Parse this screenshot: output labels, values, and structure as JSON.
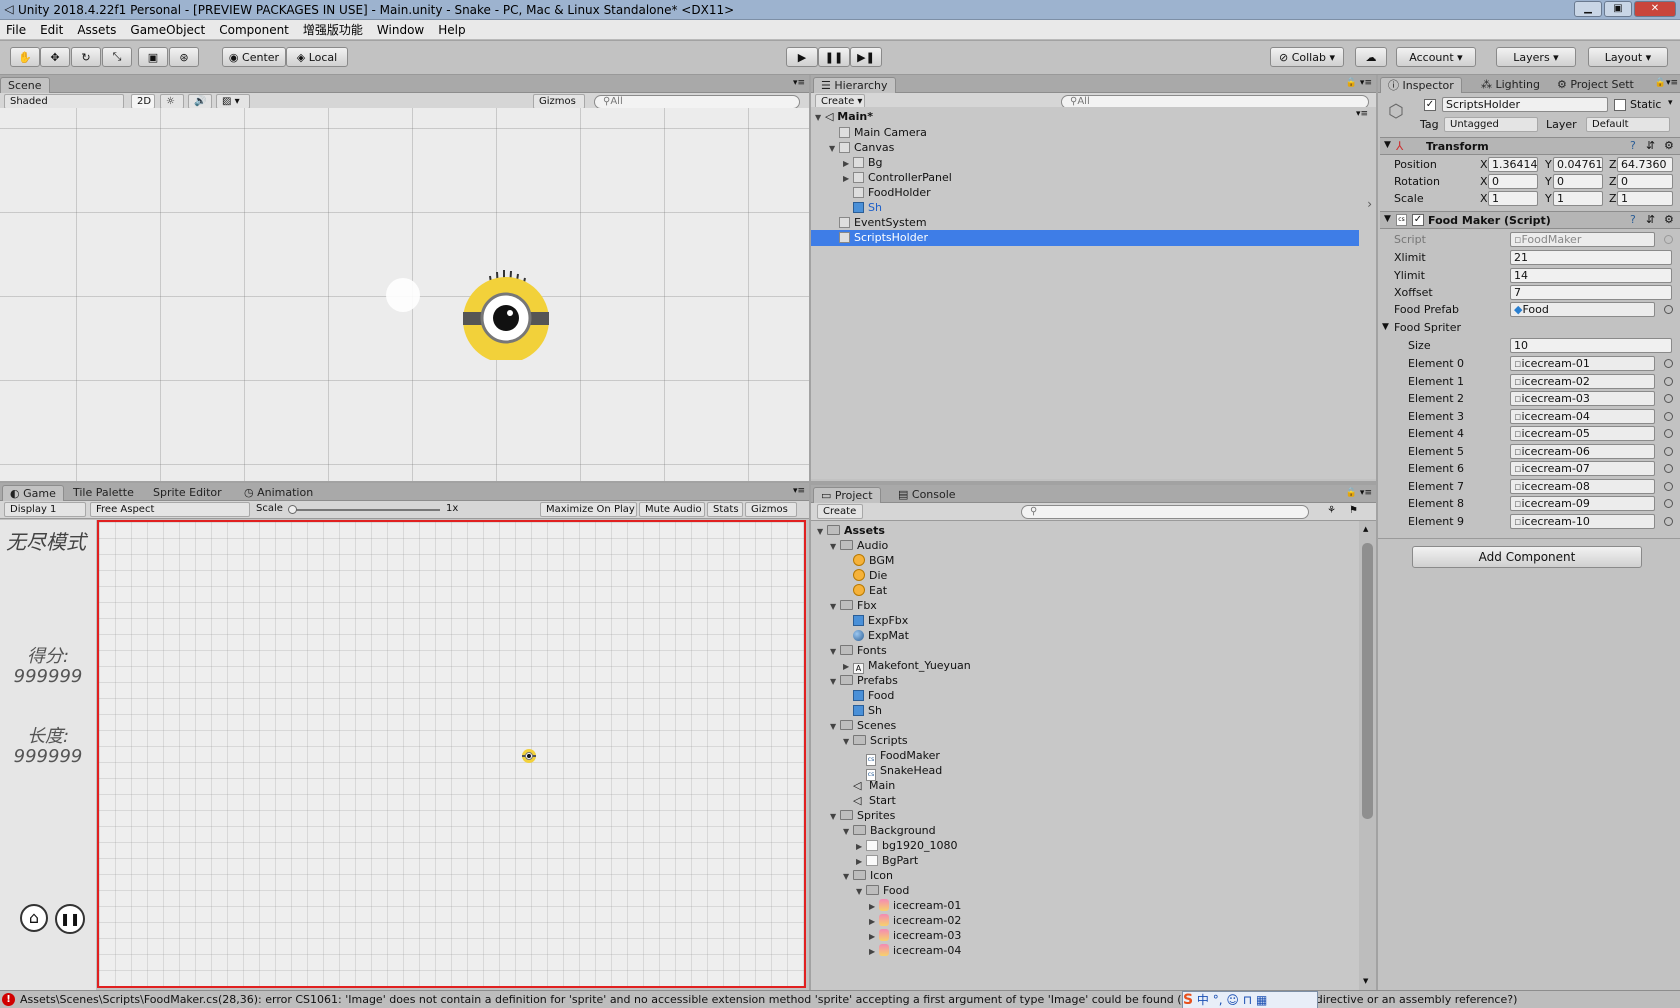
{
  "window": {
    "title": "Unity 2018.4.22f1 Personal - [PREVIEW PACKAGES IN USE] - Main.unity - Snake - PC, Mac & Linux Standalone* <DX11>",
    "controls": [
      "minimize-icon",
      "maximize-icon",
      "close-icon"
    ]
  },
  "menu": [
    "File",
    "Edit",
    "Assets",
    "GameObject",
    "Component",
    "增强版功能",
    "Window",
    "Help"
  ],
  "toolbar": {
    "pivot": "Center",
    "space": "Local",
    "collab": "Collab",
    "account": "Account",
    "layers": "Layers",
    "layout": "Layout"
  },
  "scene": {
    "tab": "Scene",
    "shading": "Shaded",
    "mode2d": "2D",
    "gizmos": "Gizmos",
    "search_placeholder": "All"
  },
  "game": {
    "tabs": [
      "Game",
      "Tile Palette",
      "Sprite Editor",
      "Animation"
    ],
    "display": "Display 1",
    "aspect": "Free Aspect",
    "scale_label": "Scale",
    "scale_value": "1x",
    "options": [
      "Maximize On Play",
      "Mute Audio",
      "Stats",
      "Gizmos"
    ],
    "mode_text": "无尽模式",
    "score_label": "得分:",
    "score_value": "999999",
    "length_label": "长度:",
    "length_value": "999999"
  },
  "hierarchy": {
    "tab": "Hierarchy",
    "create": "Create",
    "search_placeholder": "All",
    "scene": "Main*",
    "items": [
      {
        "label": "Main Camera",
        "depth": 1,
        "arrow": "",
        "blue": false,
        "selected": false
      },
      {
        "label": "Canvas",
        "depth": 1,
        "arrow": "open",
        "blue": false,
        "selected": false
      },
      {
        "label": "Bg",
        "depth": 2,
        "arrow": "closed",
        "blue": false,
        "selected": false
      },
      {
        "label": "ControllerPanel",
        "depth": 2,
        "arrow": "closed",
        "blue": false,
        "selected": false
      },
      {
        "label": "FoodHolder",
        "depth": 2,
        "arrow": "",
        "blue": false,
        "selected": false
      },
      {
        "label": "Sh",
        "depth": 2,
        "arrow": "",
        "blue": true,
        "selected": false
      },
      {
        "label": "EventSystem",
        "depth": 1,
        "arrow": "",
        "blue": false,
        "selected": false
      },
      {
        "label": "ScriptsHolder",
        "depth": 1,
        "arrow": "",
        "blue": false,
        "selected": true
      }
    ]
  },
  "project": {
    "tabs": [
      "Project",
      "Console"
    ],
    "create": "Create",
    "items": [
      {
        "label": "Assets",
        "depth": 0,
        "arrow": "open",
        "icon": "folder"
      },
      {
        "label": "Audio",
        "depth": 1,
        "arrow": "open",
        "icon": "folder"
      },
      {
        "label": "BGM",
        "depth": 2,
        "arrow": "",
        "icon": "audio"
      },
      {
        "label": "Die",
        "depth": 2,
        "arrow": "",
        "icon": "audio"
      },
      {
        "label": "Eat",
        "depth": 2,
        "arrow": "",
        "icon": "audio"
      },
      {
        "label": "Fbx",
        "depth": 1,
        "arrow": "open",
        "icon": "folder"
      },
      {
        "label": "ExpFbx",
        "depth": 2,
        "arrow": "",
        "icon": "prefab"
      },
      {
        "label": "ExpMat",
        "depth": 2,
        "arrow": "",
        "icon": "material"
      },
      {
        "label": "Fonts",
        "depth": 1,
        "arrow": "open",
        "icon": "folder"
      },
      {
        "label": "Makefont_Yueyuan",
        "depth": 2,
        "arrow": "closed",
        "icon": "font"
      },
      {
        "label": "Prefabs",
        "depth": 1,
        "arrow": "open",
        "icon": "folder"
      },
      {
        "label": "Food",
        "depth": 2,
        "arrow": "",
        "icon": "prefab"
      },
      {
        "label": "Sh",
        "depth": 2,
        "arrow": "",
        "icon": "prefab"
      },
      {
        "label": "Scenes",
        "depth": 1,
        "arrow": "open",
        "icon": "folder"
      },
      {
        "label": "Scripts",
        "depth": 2,
        "arrow": "open",
        "icon": "folder"
      },
      {
        "label": "FoodMaker",
        "depth": 3,
        "arrow": "",
        "icon": "script"
      },
      {
        "label": "SnakeHead",
        "depth": 3,
        "arrow": "",
        "icon": "script"
      },
      {
        "label": "Main",
        "depth": 2,
        "arrow": "",
        "icon": "unity"
      },
      {
        "label": "Start",
        "depth": 2,
        "arrow": "",
        "icon": "unity"
      },
      {
        "label": "Sprites",
        "depth": 1,
        "arrow": "open",
        "icon": "folder"
      },
      {
        "label": "Background",
        "depth": 2,
        "arrow": "open",
        "icon": "folder"
      },
      {
        "label": "bg1920_1080",
        "depth": 3,
        "arrow": "closed",
        "icon": "image"
      },
      {
        "label": "BgPart",
        "depth": 3,
        "arrow": "closed",
        "icon": "image"
      },
      {
        "label": "Icon",
        "depth": 2,
        "arrow": "open",
        "icon": "folder"
      },
      {
        "label": "Food",
        "depth": 3,
        "arrow": "open",
        "icon": "folder"
      },
      {
        "label": "icecream-01",
        "depth": 4,
        "arrow": "closed",
        "icon": "sprite"
      },
      {
        "label": "icecream-02",
        "depth": 4,
        "arrow": "closed",
        "icon": "sprite"
      },
      {
        "label": "icecream-03",
        "depth": 4,
        "arrow": "closed",
        "icon": "sprite"
      },
      {
        "label": "icecream-04",
        "depth": 4,
        "arrow": "closed",
        "icon": "sprite"
      }
    ]
  },
  "inspector": {
    "tabs": [
      "Inspector",
      "Lighting",
      "Project Sett"
    ],
    "object_name": "ScriptsHolder",
    "static_label": "Static",
    "tag_label": "Tag",
    "tag_value": "Untagged",
    "layer_label": "Layer",
    "layer_value": "Default",
    "transform": {
      "title": "Transform",
      "rows": [
        {
          "label": "Position",
          "x": "1.36414",
          "y": "0.04761",
          "z": "64.7360"
        },
        {
          "label": "Rotation",
          "x": "0",
          "y": "0",
          "z": "0"
        },
        {
          "label": "Scale",
          "x": "1",
          "y": "1",
          "z": "1"
        }
      ]
    },
    "food_maker": {
      "title": "Food Maker (Script)",
      "script_label": "Script",
      "script_value": "FoodMaker",
      "fields": [
        {
          "label": "Xlimit",
          "value": "21"
        },
        {
          "label": "Ylimit",
          "value": "14"
        },
        {
          "label": "Xoffset",
          "value": "7"
        }
      ],
      "prefab_label": "Food Prefab",
      "prefab_value": "Food",
      "spriter_label": "Food Spriter",
      "size_label": "Size",
      "size_value": "10",
      "elements": [
        {
          "label": "Element 0",
          "value": "icecream-01"
        },
        {
          "label": "Element 1",
          "value": "icecream-02"
        },
        {
          "label": "Element 2",
          "value": "icecream-03"
        },
        {
          "label": "Element 3",
          "value": "icecream-04"
        },
        {
          "label": "Element 4",
          "value": "icecream-05"
        },
        {
          "label": "Element 5",
          "value": "icecream-06"
        },
        {
          "label": "Element 6",
          "value": "icecream-07"
        },
        {
          "label": "Element 7",
          "value": "icecream-08"
        },
        {
          "label": "Element 8",
          "value": "icecream-09"
        },
        {
          "label": "Element 9",
          "value": "icecream-10"
        }
      ]
    },
    "add_component": "Add Component"
  },
  "status": {
    "message": "Assets\\Scenes\\Scripts\\FoodMaker.cs(28,36): error CS1061: 'Image' does not contain a definition for 'sprite' and no accessible extension method 'sprite' accepting a first argument of type 'Image' could be found (are you missing a using directive or an assembly reference?)"
  },
  "colors": {
    "selection": "#3e7de7",
    "error": "#d10000",
    "game_border": "#e02020",
    "minion_yellow": "#f2d13a"
  }
}
